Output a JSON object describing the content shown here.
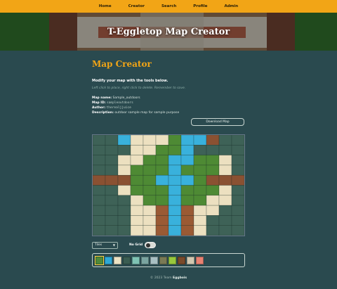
{
  "nav": {
    "items": [
      "Home",
      "Creator",
      "Search",
      "Profile",
      "Admin"
    ]
  },
  "hero": {
    "title": "T-Eggletop Map Creator"
  },
  "page": {
    "title": "Map Creator",
    "subtitle": "Modify your map with the tools below.",
    "hint": "Left click to place, right click to delete. Remember to save.",
    "meta": {
      "name_label": "Map name:",
      "name_value": "Sample_outdoors",
      "id_label": "Map ID:",
      "id_value": "sampleoutdoors",
      "author_label": "Author:",
      "author_value": "therealjjuice",
      "desc_label": "Description:",
      "desc_value": "outdoor sample map for sample purpose"
    }
  },
  "toolbar": {
    "download_label": "Download Map"
  },
  "controls": {
    "layer_select": "Tiles",
    "nogrid_label": "No Grid",
    "toggle_on": false
  },
  "palette": {
    "colors": [
      "#4f8a3a",
      "#2fa8d6",
      "#ece3c4",
      "#3a5d52",
      "#7fc3b4",
      "#7aa4a0",
      "#a9c0c3",
      "#7a7a55",
      "#98c83c",
      "#7a4a2a",
      "#d2c8b0",
      "#e98272"
    ],
    "icons": [
      "grass-icon",
      "water-icon",
      "sand-icon",
      "dark-stone-icon",
      "teal-icon",
      "slate-icon",
      "ice-icon",
      "dirt-icon",
      "moss-icon",
      "wood-icon",
      "gravel-icon",
      "brick-icon"
    ],
    "selected_index": 0
  },
  "footer": {
    "prefix": "© 2023 Team",
    "team": "Eggbois"
  },
  "map": {
    "rows": [
      "SSWPPPGWWRSS",
      "SSSPPGGWSSSS",
      "SSPPGGWWGGPS",
      "SSPGGGWGGGPS",
      "RRRGGWWWGRRR",
      "SSPGGGWGGGPS",
      "SSSPGGWGGPPS",
      "SSSPPBWBPPSS",
      "SSSPPBWBPSSS",
      "SSSPPBWBPSSS"
    ],
    "tile_colors": {
      "S": "#3e6257",
      "P": "#ece0c0",
      "G": "#4e8a34",
      "W": "#39b1dc",
      "R": "#8a5132",
      "B": "#9a5a34"
    }
  }
}
